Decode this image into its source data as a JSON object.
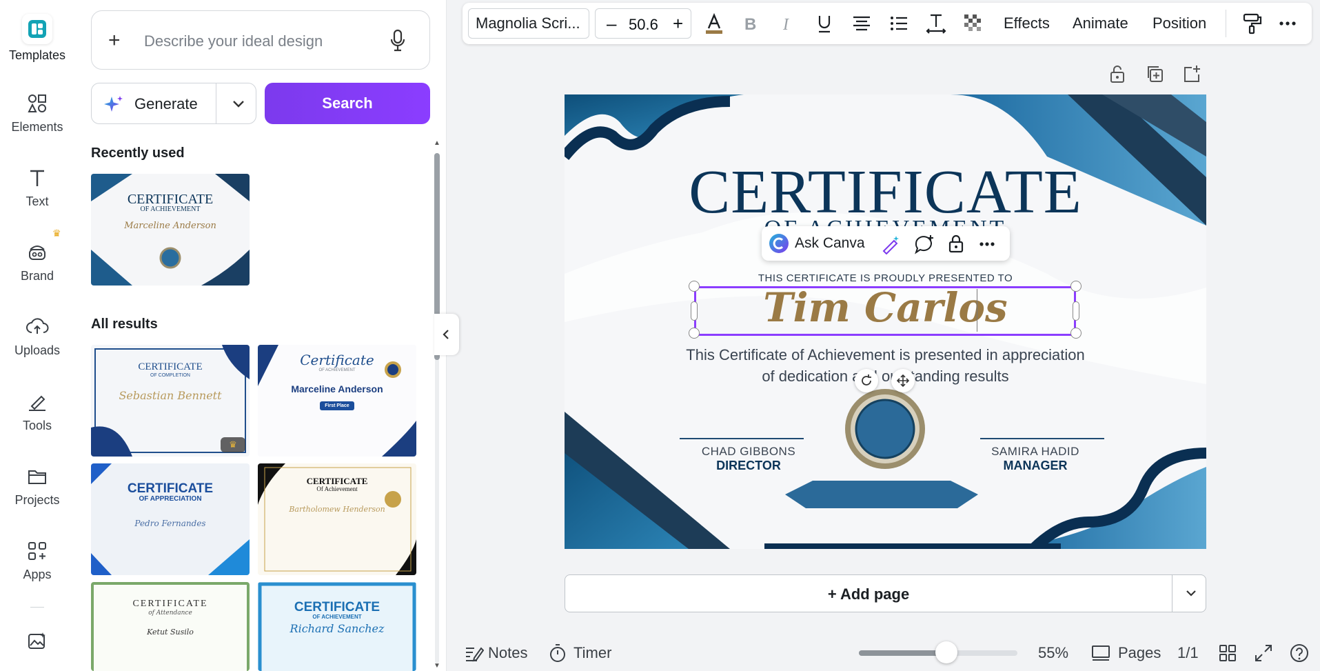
{
  "rail": {
    "items": [
      {
        "label": "Templates",
        "icon": "templates-icon"
      },
      {
        "label": "Elements",
        "icon": "elements-icon"
      },
      {
        "label": "Text",
        "icon": "text-icon"
      },
      {
        "label": "Brand",
        "icon": "brand-icon"
      },
      {
        "label": "Uploads",
        "icon": "uploads-icon"
      },
      {
        "label": "Tools",
        "icon": "tools-icon"
      },
      {
        "label": "Projects",
        "icon": "projects-icon"
      },
      {
        "label": "Apps",
        "icon": "apps-icon"
      }
    ]
  },
  "panel": {
    "prompt_placeholder": "Describe your ideal design",
    "generate_label": "Generate",
    "search_label": "Search",
    "recently_used": "Recently used",
    "all_results": "All results",
    "recent_thumb": {
      "title": "CERTIFICATE",
      "subtitle": "OF ACHIEVEMENT",
      "name": "Marceline Anderson"
    },
    "results": [
      {
        "title": "CERTIFICATE",
        "subtitle": "OF COMPLETION",
        "name": "Sebastian Bennett"
      },
      {
        "title": "Certificate",
        "subtitle": "OF ACHIEVEMENT",
        "name": "Marceline Anderson",
        "badge": "First Place"
      },
      {
        "title": "CERTIFICATE",
        "subtitle": "OF APPRECIATION",
        "name": "Pedro Fernandes"
      },
      {
        "title": "CERTIFICATE",
        "subtitle": "Of Achievement",
        "name": "Bartholomew Henderson"
      },
      {
        "title": "CERTIFICATE",
        "subtitle": "of Attendance",
        "name": "Ketut Susilo"
      },
      {
        "title": "CERTIFICATE",
        "subtitle": "OF ACHIEVEMENT",
        "name": "Richard Sanchez"
      }
    ]
  },
  "toolbar": {
    "font": "Magnolia Scri...",
    "size": "50.6",
    "minus": "–",
    "plus": "+",
    "effects": "Effects",
    "animate": "Animate",
    "position": "Position"
  },
  "certificate": {
    "title": "CERTIFICATE",
    "subtitle": "OF ACHIEVEMENT",
    "presented": "THIS CERTIFICATE IS PROUDLY PRESENTED TO",
    "name": "Tim Carlos",
    "body_line1": "This Certificate of Achievement is presented in appreciation",
    "body_line2": "of dedication and outstanding results",
    "sig1_name": "CHAD GIBBONS",
    "sig1_role": "DIRECTOR",
    "sig2_name": "SAMIRA HADID",
    "sig2_role": "MANAGER"
  },
  "ask_canva": "Ask Canva",
  "add_page": "+ Add page",
  "bottom": {
    "notes": "Notes",
    "timer": "Timer",
    "zoom": "55%",
    "zoom_fraction": 0.55,
    "pages": "Pages",
    "page_count": "1/1"
  },
  "colors": {
    "accent": "#8b3dff",
    "navy": "#0c3559",
    "gold": "#9a7a45"
  }
}
